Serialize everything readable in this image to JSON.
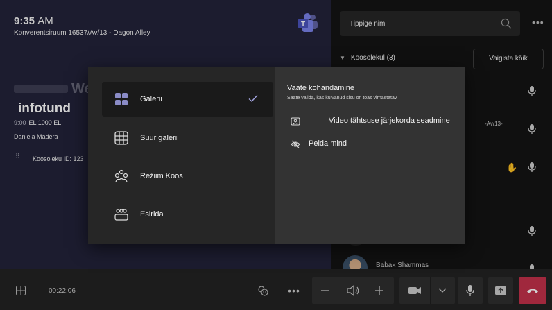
{
  "room": {
    "time": "9:35",
    "ampm": "AM",
    "name": "Konverentsiruum 16537/Av/13 - Dagon Alley",
    "welcome_fragment": "We",
    "meeting_title": "infotund",
    "meeting_time": "9:00",
    "meeting_tag": "EL 1000 EL",
    "organizer": "Daniela Madera",
    "meeting_id_label": "Koosoleku ID: 123"
  },
  "participants": {
    "search_placeholder": "Tippige nimi",
    "section_label": "Koosolekul (3)",
    "mute_all_label": "Vaigista kõik",
    "row_snippet": "-Av/13-",
    "last_name": "Babak Shammas"
  },
  "bar": {
    "timer": "00:22:06"
  },
  "popup": {
    "layouts": [
      {
        "label": "Galerii",
        "icon": "gallery-icon",
        "selected": true
      },
      {
        "label": "Suur galerii",
        "icon": "large-gallery-icon",
        "selected": false
      },
      {
        "label": "Režiim Koos",
        "icon": "together-mode-icon",
        "selected": false
      },
      {
        "label": "Esirida",
        "icon": "front-row-icon",
        "selected": false
      }
    ],
    "customize_title": "Vaate kohandamine",
    "customize_sub": "Saate valida, kas kuivanud sisu on toas virnastatav",
    "video_priority_label": "Video tähtsuse järjekorda seadmine",
    "hide_me_label": "Peida mind"
  },
  "colors": {
    "room_bg": "#23233a",
    "panel_bg": "#141414",
    "hangup": "#c4314b",
    "accent": "#8b8cc7"
  }
}
